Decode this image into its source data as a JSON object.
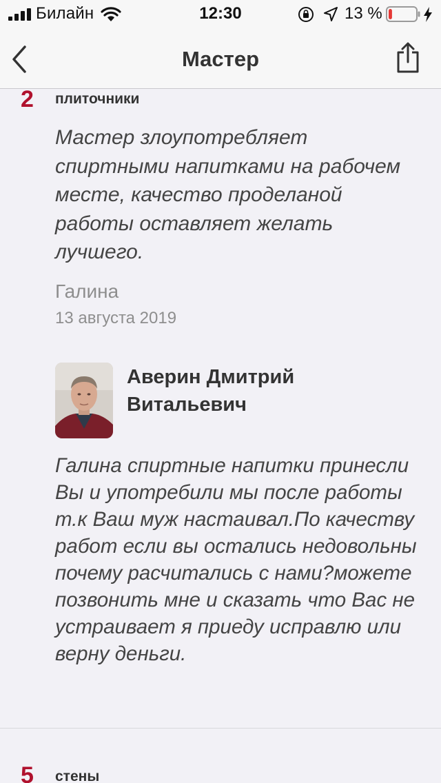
{
  "status_bar": {
    "carrier": "Билайн",
    "time": "12:30",
    "battery_percent": "13 %",
    "battery_level": 0.13,
    "battery_color": "#e53935"
  },
  "nav": {
    "title": "Мастер",
    "back_icon": "chevron-left-icon",
    "share_icon": "share-icon"
  },
  "review": {
    "rating": "2",
    "category": "плиточники",
    "text": "Мастер злоупотребляет спиртными напитками на рабочем месте, качество проделаной работы оставляет желать лучшего.",
    "author": "Галина",
    "date": "13 августа 2019"
  },
  "reply": {
    "master_name": "Аверин Дмитрий Витальевич",
    "text": "Галина спиртные напитки принесли Вы и употребили мы после работы т.к Ваш муж настаивал.По качеству работ если вы остались недовольны почему расчитались с нами?можете позвонить мне и сказать что Вас не устраивает я приеду исправлю или верну деньги."
  },
  "next_review": {
    "rating": "5",
    "category": "стены"
  },
  "colors": {
    "accent": "#b0112d",
    "background": "#f2f1f6",
    "muted_text": "#8e8e8e"
  }
}
